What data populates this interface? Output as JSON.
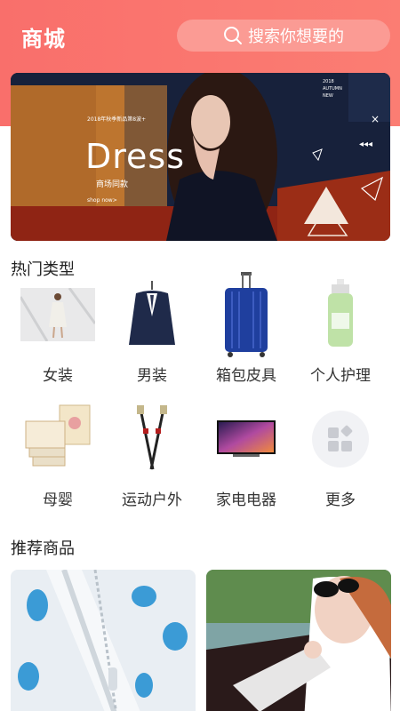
{
  "header": {
    "title": "商城",
    "search_placeholder": "搜索你想要的"
  },
  "banner": {
    "promo_line": "2018年秋季新品第8波+",
    "headline": "Dress",
    "sub_label": "商场同款",
    "cta": "shop now>",
    "year": "2018",
    "season_1": "AUTUMN",
    "season_2": "NEW"
  },
  "hot_categories": {
    "title": "热门类型",
    "items": [
      {
        "label": "女装",
        "icon": "womens-clothing-icon"
      },
      {
        "label": "男装",
        "icon": "mens-suit-icon"
      },
      {
        "label": "箱包皮具",
        "icon": "luggage-icon"
      },
      {
        "label": "个人护理",
        "icon": "lotion-bottle-icon"
      },
      {
        "label": "母婴",
        "icon": "baby-products-icon"
      },
      {
        "label": "运动户外",
        "icon": "trekking-poles-icon"
      },
      {
        "label": "家电电器",
        "icon": "tv-icon"
      },
      {
        "label": "更多",
        "icon": "more-grid-icon"
      }
    ]
  },
  "recommended": {
    "title": "推荐商品"
  },
  "colors": {
    "header": "#f96f6b",
    "search_bg": "#fb9b94",
    "accent": "#e84f48"
  }
}
